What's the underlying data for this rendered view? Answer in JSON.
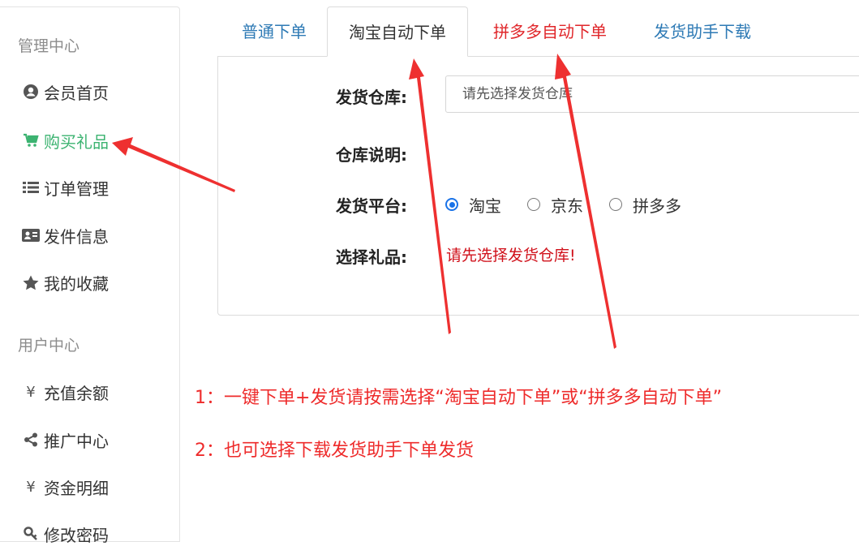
{
  "sidebar": {
    "section1_title": "管理中心",
    "items1": [
      {
        "label": "会员首页",
        "icon": "user-circle-icon"
      },
      {
        "label": "购买礼品",
        "icon": "cart-icon"
      },
      {
        "label": "订单管理",
        "icon": "list-icon"
      },
      {
        "label": "发件信息",
        "icon": "id-card-icon"
      },
      {
        "label": "我的收藏",
        "icon": "star-icon"
      }
    ],
    "section2_title": "用户中心",
    "items2": [
      {
        "label": "充值余额",
        "icon": "yen-icon",
        "glyph": "¥"
      },
      {
        "label": "推广中心",
        "icon": "share-icon"
      },
      {
        "label": "资金明细",
        "icon": "yen-icon",
        "glyph": "¥"
      },
      {
        "label": "修改密码",
        "icon": "key-icon"
      }
    ],
    "active_item": "购买礼品",
    "active_color": "#3cb371"
  },
  "tabs": [
    {
      "label": "普通下单"
    },
    {
      "label": "淘宝自动下单"
    },
    {
      "label": "拼多多自动下单"
    },
    {
      "label": "发货助手下载"
    }
  ],
  "active_tab": "淘宝自动下单",
  "form": {
    "warehouse_label": "发货仓库:",
    "warehouse_placeholder": "请先选择发货仓库",
    "desc_label": "仓库说明:",
    "platform_label": "发货平台:",
    "platforms": [
      "淘宝",
      "京东",
      "拼多多"
    ],
    "selected_platform": "淘宝",
    "gift_label": "选择礼品:",
    "gift_warning": "请先选择发货仓库!"
  },
  "notes": [
    "1：一键下单+发货请按需选择“淘宝自动下单”或“拼多多自动下单”",
    "2：也可选择下载发货助手下单发货"
  ],
  "colors": {
    "link_blue": "#2e7ab5",
    "annotation_red": "#ee2b2b",
    "radio_blue": "#1a73e8"
  }
}
